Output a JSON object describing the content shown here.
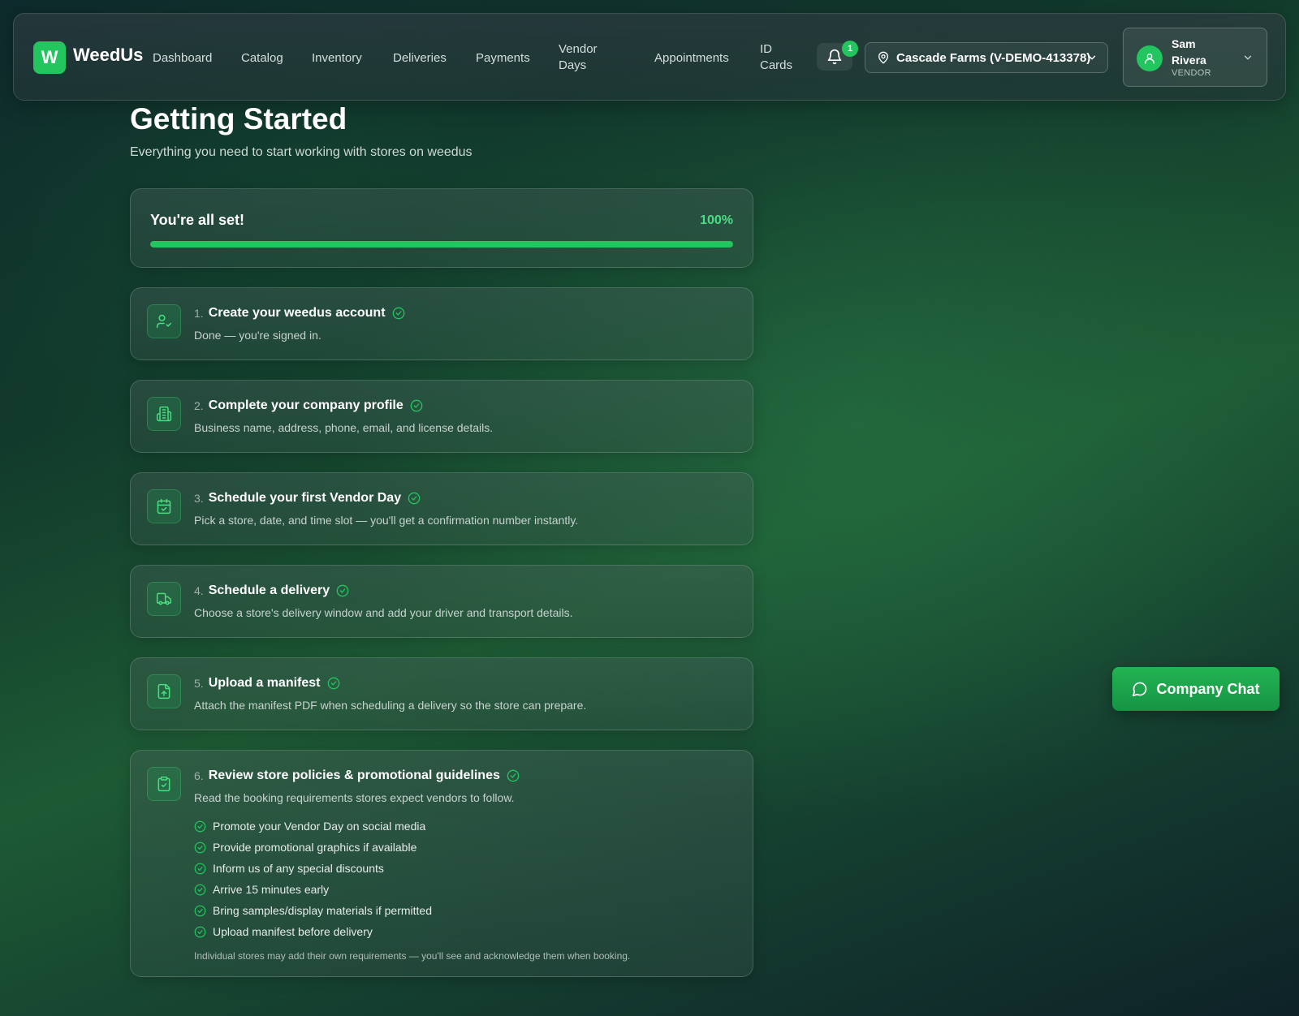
{
  "app": {
    "logo_letter": "W",
    "name": "WeedUs"
  },
  "nav": {
    "dashboard": "Dashboard",
    "catalog": "Catalog",
    "inventory": "Inventory",
    "deliveries": "Deliveries",
    "payments": "Payments",
    "vendor_days": "Vendor Days",
    "appointments": "Appointments",
    "id_cards": "ID Cards"
  },
  "notifications": {
    "count": "1"
  },
  "location": {
    "label": "Cascade Farms (V-DEMO-413378)"
  },
  "user": {
    "name": "Sam Rivera",
    "role": "VENDOR"
  },
  "page": {
    "title": "Getting Started",
    "subtitle": "Everything you need to start working with stores on weedus"
  },
  "progress": {
    "title": "You're all set!",
    "label": "100%",
    "fraction": 1.0
  },
  "steps": [
    {
      "number": "1.",
      "title": "Create your weedus account",
      "desc": "Done — you're signed in.",
      "icon": "user-check-icon",
      "completed": true
    },
    {
      "number": "2.",
      "title": "Complete your company profile",
      "desc": "Business name, address, phone, email, and license details.",
      "icon": "building-icon",
      "completed": true
    },
    {
      "number": "3.",
      "title": "Schedule your first Vendor Day",
      "desc": "Pick a store, date, and time slot — you'll get a confirmation number instantly.",
      "icon": "calendar-check-icon",
      "completed": true
    },
    {
      "number": "4.",
      "title": "Schedule a delivery",
      "desc": "Choose a store's delivery window and add your driver and transport details.",
      "icon": "truck-icon",
      "completed": true
    },
    {
      "number": "5.",
      "title": "Upload a manifest",
      "desc": "Attach the manifest PDF when scheduling a delivery so the store can prepare.",
      "icon": "file-upload-icon",
      "completed": true
    },
    {
      "number": "6.",
      "title": "Review store policies & promotional guidelines",
      "desc": "Read the booking requirements stores expect vendors to follow.",
      "icon": "clipboard-check-icon",
      "completed": true
    }
  ],
  "requirements": [
    "Promote your Vendor Day on social media",
    "Provide promotional graphics if available",
    "Inform us of any special discounts",
    "Arrive 15 minutes early",
    "Bring samples/display materials if permitted",
    "Upload manifest before delivery"
  ],
  "requirements_note": "Individual stores may add their own requirements — you'll see and acknowledge them when booking.",
  "chat": {
    "label": "Company Chat"
  },
  "colors": {
    "accent": "#22c55e",
    "accent_light": "#4ade80"
  }
}
